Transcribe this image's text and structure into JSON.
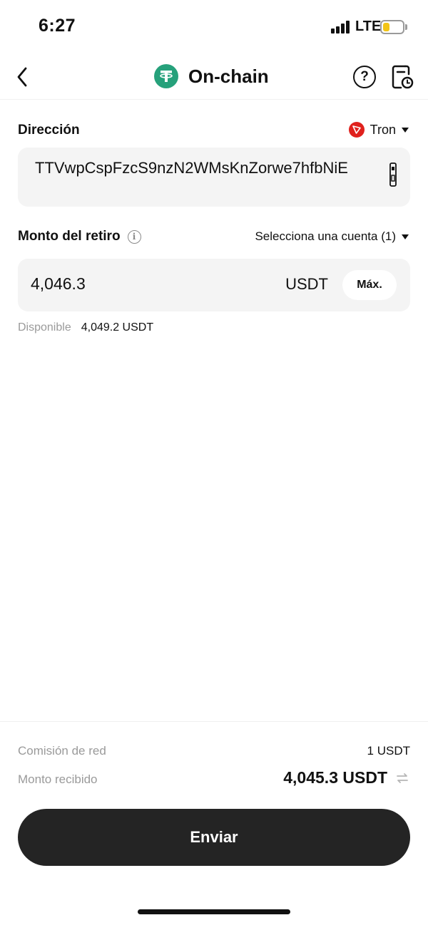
{
  "status_bar": {
    "time": "6:27",
    "network": "LTE",
    "battery_level": 0.35,
    "battery_color": "#f2c417"
  },
  "header": {
    "title": "On-chain",
    "coin_icon": "tether-icon",
    "help_icon": "help-circle-icon",
    "history_icon": "history-icon"
  },
  "address": {
    "label": "Dirección",
    "network": "Tron",
    "value": "TTVwpCspFzcS9nzN2WMsKnZorwe7hfbNiE"
  },
  "amount": {
    "label": "Monto del retiro",
    "account_selector": "Selecciona una cuenta (1)",
    "value": "4,046.3",
    "currency": "USDT",
    "max_label": "Máx.",
    "available_label": "Disponible",
    "available_value": "4,049.2 USDT"
  },
  "summary": {
    "fee_label": "Comisión de red",
    "fee_value": "1 USDT",
    "received_label": "Monto recibido",
    "received_value": "4,045.3 USDT"
  },
  "actions": {
    "send_label": "Enviar"
  },
  "colors": {
    "accent": "#242424",
    "usdt": "#26a17b",
    "tron": "#e0211d",
    "field_bg": "#f4f4f4",
    "muted_text": "#9a9a9a"
  }
}
